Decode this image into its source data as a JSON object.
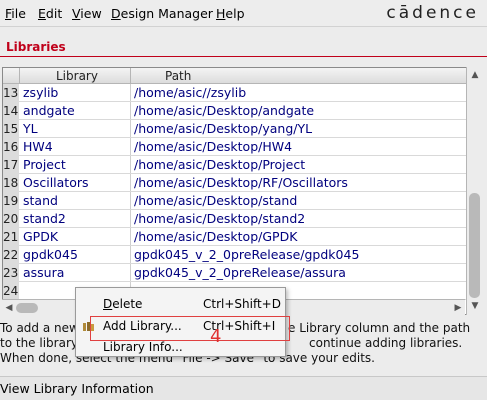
{
  "menubar": {
    "items": [
      "File",
      "Edit",
      "View",
      "Design Manager",
      "Help"
    ],
    "underline_first": [
      "F",
      "E",
      "V",
      "D",
      "H"
    ],
    "rest": [
      "ile",
      "dit",
      "iew",
      "esign Manager",
      "elp"
    ],
    "logo": "cādence"
  },
  "section": {
    "title": "Libraries"
  },
  "table": {
    "headers": {
      "library": "Library",
      "path": "Path"
    },
    "rows": [
      {
        "num": "13",
        "library": "zsylib",
        "path": "/home/asic//zsylib"
      },
      {
        "num": "14",
        "library": "andgate",
        "path": "/home/asic/Desktop/andgate"
      },
      {
        "num": "15",
        "library": "YL",
        "path": "/home/asic/Desktop/yang/YL"
      },
      {
        "num": "16",
        "library": "HW4",
        "path": "/home/asic/Desktop/HW4"
      },
      {
        "num": "17",
        "library": "Project",
        "path": "/home/asic/Desktop/Project"
      },
      {
        "num": "18",
        "library": "Oscillators",
        "path": "/home/asic/Desktop/RF/Oscillators"
      },
      {
        "num": "19",
        "library": "stand",
        "path": "/home/asic/Desktop/stand"
      },
      {
        "num": "20",
        "library": "stand2",
        "path": "/home/asic/Desktop/stand2"
      },
      {
        "num": "21",
        "library": "GPDK",
        "path": "/home/asic/Desktop/GPDK"
      },
      {
        "num": "22",
        "library": "gpdk045",
        "path": "gpdk045_v_2_0preRelease/gpdk045"
      },
      {
        "num": "23",
        "library": "assura",
        "path": "gpdk045_v_2_0preRelease/assura"
      },
      {
        "num": "24",
        "library": "",
        "path": ""
      }
    ]
  },
  "help": {
    "line1_left": "To add a new",
    "line1_right": "e Library column and the path",
    "line2_left": "to the library i",
    "line2_right": "continue adding libraries.",
    "line3": "When done, select the menu \"File -> Save\" to save your edits."
  },
  "context_menu": {
    "items": [
      {
        "label": "Delete",
        "shortcut": "Ctrl+Shift+D"
      },
      {
        "label": "Add Library...",
        "shortcut": "Ctrl+Shift+I"
      },
      {
        "label": "Library Info...",
        "shortcut": ""
      }
    ]
  },
  "annotation": {
    "step": "4"
  },
  "status": {
    "text": "View Library Information"
  },
  "colors": {
    "accent": "#c0001a",
    "link": "#00007e",
    "annotation": "#e03030"
  }
}
